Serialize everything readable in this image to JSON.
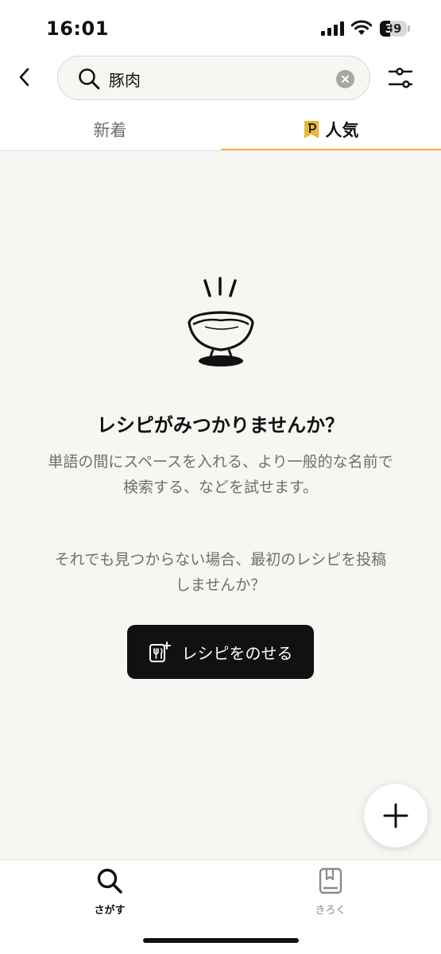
{
  "status_bar": {
    "time": "16:01",
    "battery_level": "39",
    "icons": [
      "cellular-signal-icon",
      "wifi-icon",
      "battery-icon"
    ]
  },
  "header": {
    "back_icon": "chevron-left-icon",
    "search": {
      "value": "豚肉",
      "icon": "search-icon",
      "clear_icon": "clear-icon"
    },
    "filter_icon": "filter-sliders-icon"
  },
  "tabs": [
    {
      "label": "新着",
      "active": false
    },
    {
      "label": "人気",
      "active": true,
      "icon": "premium-p-icon"
    }
  ],
  "empty_state": {
    "illustration": "rice-bowl-icon",
    "title": "レシピがみつかりませんか？",
    "hint_line1": "単語の間にスペースを入れる、より一般的な名前で",
    "hint_line2": "検索する、などを試せます。",
    "suggestion_line1": "それでも見つからない場合、最初のレシピを投稿",
    "suggestion_line2": "しませんか？",
    "post_button_label": "レシピをのせる",
    "post_button_icon": "recipe-add-icon"
  },
  "fab": {
    "icon": "plus-icon"
  },
  "bottom_nav": [
    {
      "label": "さがす",
      "icon": "search-icon",
      "active": true
    },
    {
      "label": "きろく",
      "icon": "bookmark-book-icon",
      "active": false
    }
  ],
  "colors": {
    "accent": "#e7b83a",
    "background": "#f8f6f2",
    "button": "#111111",
    "muted_text": "#6f6f6f"
  }
}
